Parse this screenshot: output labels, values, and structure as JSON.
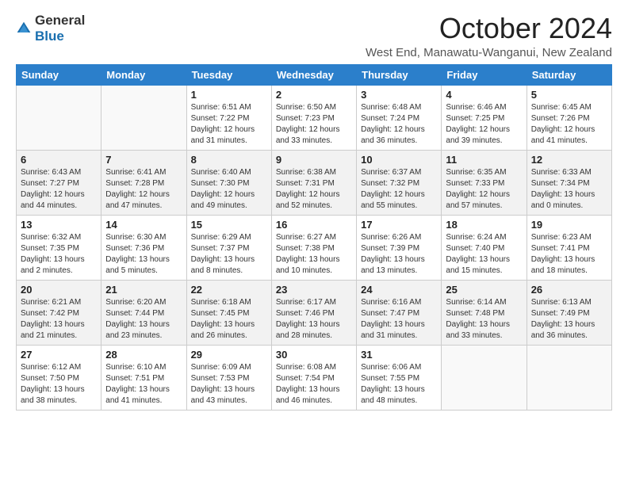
{
  "logo": {
    "text_general": "General",
    "text_blue": "Blue"
  },
  "title": "October 2024",
  "subtitle": "West End, Manawatu-Wanganui, New Zealand",
  "headers": [
    "Sunday",
    "Monday",
    "Tuesday",
    "Wednesday",
    "Thursday",
    "Friday",
    "Saturday"
  ],
  "weeks": [
    [
      {
        "day": "",
        "sunrise": "",
        "sunset": "",
        "daylight": ""
      },
      {
        "day": "",
        "sunrise": "",
        "sunset": "",
        "daylight": ""
      },
      {
        "day": "1",
        "sunrise": "Sunrise: 6:51 AM",
        "sunset": "Sunset: 7:22 PM",
        "daylight": "Daylight: 12 hours and 31 minutes."
      },
      {
        "day": "2",
        "sunrise": "Sunrise: 6:50 AM",
        "sunset": "Sunset: 7:23 PM",
        "daylight": "Daylight: 12 hours and 33 minutes."
      },
      {
        "day": "3",
        "sunrise": "Sunrise: 6:48 AM",
        "sunset": "Sunset: 7:24 PM",
        "daylight": "Daylight: 12 hours and 36 minutes."
      },
      {
        "day": "4",
        "sunrise": "Sunrise: 6:46 AM",
        "sunset": "Sunset: 7:25 PM",
        "daylight": "Daylight: 12 hours and 39 minutes."
      },
      {
        "day": "5",
        "sunrise": "Sunrise: 6:45 AM",
        "sunset": "Sunset: 7:26 PM",
        "daylight": "Daylight: 12 hours and 41 minutes."
      }
    ],
    [
      {
        "day": "6",
        "sunrise": "Sunrise: 6:43 AM",
        "sunset": "Sunset: 7:27 PM",
        "daylight": "Daylight: 12 hours and 44 minutes."
      },
      {
        "day": "7",
        "sunrise": "Sunrise: 6:41 AM",
        "sunset": "Sunset: 7:28 PM",
        "daylight": "Daylight: 12 hours and 47 minutes."
      },
      {
        "day": "8",
        "sunrise": "Sunrise: 6:40 AM",
        "sunset": "Sunset: 7:30 PM",
        "daylight": "Daylight: 12 hours and 49 minutes."
      },
      {
        "day": "9",
        "sunrise": "Sunrise: 6:38 AM",
        "sunset": "Sunset: 7:31 PM",
        "daylight": "Daylight: 12 hours and 52 minutes."
      },
      {
        "day": "10",
        "sunrise": "Sunrise: 6:37 AM",
        "sunset": "Sunset: 7:32 PM",
        "daylight": "Daylight: 12 hours and 55 minutes."
      },
      {
        "day": "11",
        "sunrise": "Sunrise: 6:35 AM",
        "sunset": "Sunset: 7:33 PM",
        "daylight": "Daylight: 12 hours and 57 minutes."
      },
      {
        "day": "12",
        "sunrise": "Sunrise: 6:33 AM",
        "sunset": "Sunset: 7:34 PM",
        "daylight": "Daylight: 13 hours and 0 minutes."
      }
    ],
    [
      {
        "day": "13",
        "sunrise": "Sunrise: 6:32 AM",
        "sunset": "Sunset: 7:35 PM",
        "daylight": "Daylight: 13 hours and 2 minutes."
      },
      {
        "day": "14",
        "sunrise": "Sunrise: 6:30 AM",
        "sunset": "Sunset: 7:36 PM",
        "daylight": "Daylight: 13 hours and 5 minutes."
      },
      {
        "day": "15",
        "sunrise": "Sunrise: 6:29 AM",
        "sunset": "Sunset: 7:37 PM",
        "daylight": "Daylight: 13 hours and 8 minutes."
      },
      {
        "day": "16",
        "sunrise": "Sunrise: 6:27 AM",
        "sunset": "Sunset: 7:38 PM",
        "daylight": "Daylight: 13 hours and 10 minutes."
      },
      {
        "day": "17",
        "sunrise": "Sunrise: 6:26 AM",
        "sunset": "Sunset: 7:39 PM",
        "daylight": "Daylight: 13 hours and 13 minutes."
      },
      {
        "day": "18",
        "sunrise": "Sunrise: 6:24 AM",
        "sunset": "Sunset: 7:40 PM",
        "daylight": "Daylight: 13 hours and 15 minutes."
      },
      {
        "day": "19",
        "sunrise": "Sunrise: 6:23 AM",
        "sunset": "Sunset: 7:41 PM",
        "daylight": "Daylight: 13 hours and 18 minutes."
      }
    ],
    [
      {
        "day": "20",
        "sunrise": "Sunrise: 6:21 AM",
        "sunset": "Sunset: 7:42 PM",
        "daylight": "Daylight: 13 hours and 21 minutes."
      },
      {
        "day": "21",
        "sunrise": "Sunrise: 6:20 AM",
        "sunset": "Sunset: 7:44 PM",
        "daylight": "Daylight: 13 hours and 23 minutes."
      },
      {
        "day": "22",
        "sunrise": "Sunrise: 6:18 AM",
        "sunset": "Sunset: 7:45 PM",
        "daylight": "Daylight: 13 hours and 26 minutes."
      },
      {
        "day": "23",
        "sunrise": "Sunrise: 6:17 AM",
        "sunset": "Sunset: 7:46 PM",
        "daylight": "Daylight: 13 hours and 28 minutes."
      },
      {
        "day": "24",
        "sunrise": "Sunrise: 6:16 AM",
        "sunset": "Sunset: 7:47 PM",
        "daylight": "Daylight: 13 hours and 31 minutes."
      },
      {
        "day": "25",
        "sunrise": "Sunrise: 6:14 AM",
        "sunset": "Sunset: 7:48 PM",
        "daylight": "Daylight: 13 hours and 33 minutes."
      },
      {
        "day": "26",
        "sunrise": "Sunrise: 6:13 AM",
        "sunset": "Sunset: 7:49 PM",
        "daylight": "Daylight: 13 hours and 36 minutes."
      }
    ],
    [
      {
        "day": "27",
        "sunrise": "Sunrise: 6:12 AM",
        "sunset": "Sunset: 7:50 PM",
        "daylight": "Daylight: 13 hours and 38 minutes."
      },
      {
        "day": "28",
        "sunrise": "Sunrise: 6:10 AM",
        "sunset": "Sunset: 7:51 PM",
        "daylight": "Daylight: 13 hours and 41 minutes."
      },
      {
        "day": "29",
        "sunrise": "Sunrise: 6:09 AM",
        "sunset": "Sunset: 7:53 PM",
        "daylight": "Daylight: 13 hours and 43 minutes."
      },
      {
        "day": "30",
        "sunrise": "Sunrise: 6:08 AM",
        "sunset": "Sunset: 7:54 PM",
        "daylight": "Daylight: 13 hours and 46 minutes."
      },
      {
        "day": "31",
        "sunrise": "Sunrise: 6:06 AM",
        "sunset": "Sunset: 7:55 PM",
        "daylight": "Daylight: 13 hours and 48 minutes."
      },
      {
        "day": "",
        "sunrise": "",
        "sunset": "",
        "daylight": ""
      },
      {
        "day": "",
        "sunrise": "",
        "sunset": "",
        "daylight": ""
      }
    ]
  ]
}
